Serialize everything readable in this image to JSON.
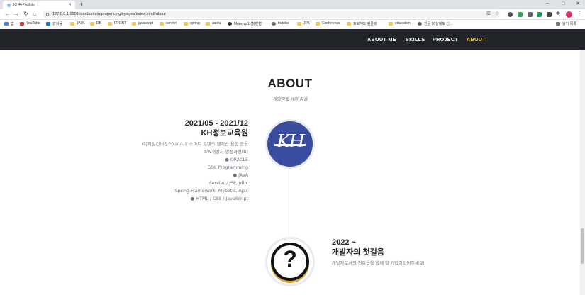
{
  "browser": {
    "tab_title": "KH4+Portfolio",
    "url": "127.0.0.1:5501/startbootstrap-agency-gh-pages/index.html#about",
    "window_controls": [
      "−",
      "□",
      "✕"
    ]
  },
  "bookmarks": [
    {
      "label": "앱",
      "icon": "apps-grid-icon"
    },
    {
      "label": "YouTube",
      "icon": "youtube-icon"
    },
    {
      "label": "강의동",
      "icon": "bookmark-icon"
    },
    {
      "label": "JAVA",
      "icon": "folder-icon"
    },
    {
      "label": "DB",
      "icon": "folder-icon"
    },
    {
      "label": "FRONT",
      "icon": "folder-icon"
    },
    {
      "label": "javascript",
      "icon": "folder-icon"
    },
    {
      "label": "servlet",
      "icon": "folder-icon"
    },
    {
      "label": "spring",
      "icon": "folder-icon"
    },
    {
      "label": "useful",
      "icon": "folder-icon"
    },
    {
      "label": "Mrimyup1 (장민협)",
      "icon": "github-icon"
    },
    {
      "label": "todolist",
      "icon": "globe-icon"
    },
    {
      "label": "JPA",
      "icon": "folder-icon"
    },
    {
      "label": "Conference",
      "icon": "folder-icon"
    },
    {
      "label": "프로젝트 템플릿",
      "icon": "folder-icon"
    },
    {
      "label": "education",
      "icon": "folder-icon"
    },
    {
      "label": "한글 30살에도 신...",
      "icon": "globe-icon"
    }
  ],
  "reading_list": "읽기 목록",
  "nav": {
    "items": [
      "ABOUT ME",
      "SKILLS",
      "PROJECT",
      "ABOUT"
    ],
    "active_color": "#fec810"
  },
  "about": {
    "title": "ABOUT",
    "subtitle": "개발자로서의 꿈을",
    "timeline": [
      {
        "period": "2021/05 - 2021/12",
        "heading": "KH정보교육원",
        "lines": [
          "(디지털컨버전스) UI/UX 스마트 콘텐츠 웹기반 융합 응용",
          "SW개발자 양성과정(B)",
          "● ORACLE",
          "SQL Programming",
          "● JAVA",
          "Servlet / JSP, jdbc",
          "Spring Framework, Mybatis, Ajax",
          "● HTML / CSS / JavaScript"
        ]
      },
      {
        "period": "2022 ~",
        "heading": "개발자의 첫걸음",
        "description": "개발자로서의 첫걸음을 함께 할 기업이되어주세요!!"
      }
    ]
  }
}
